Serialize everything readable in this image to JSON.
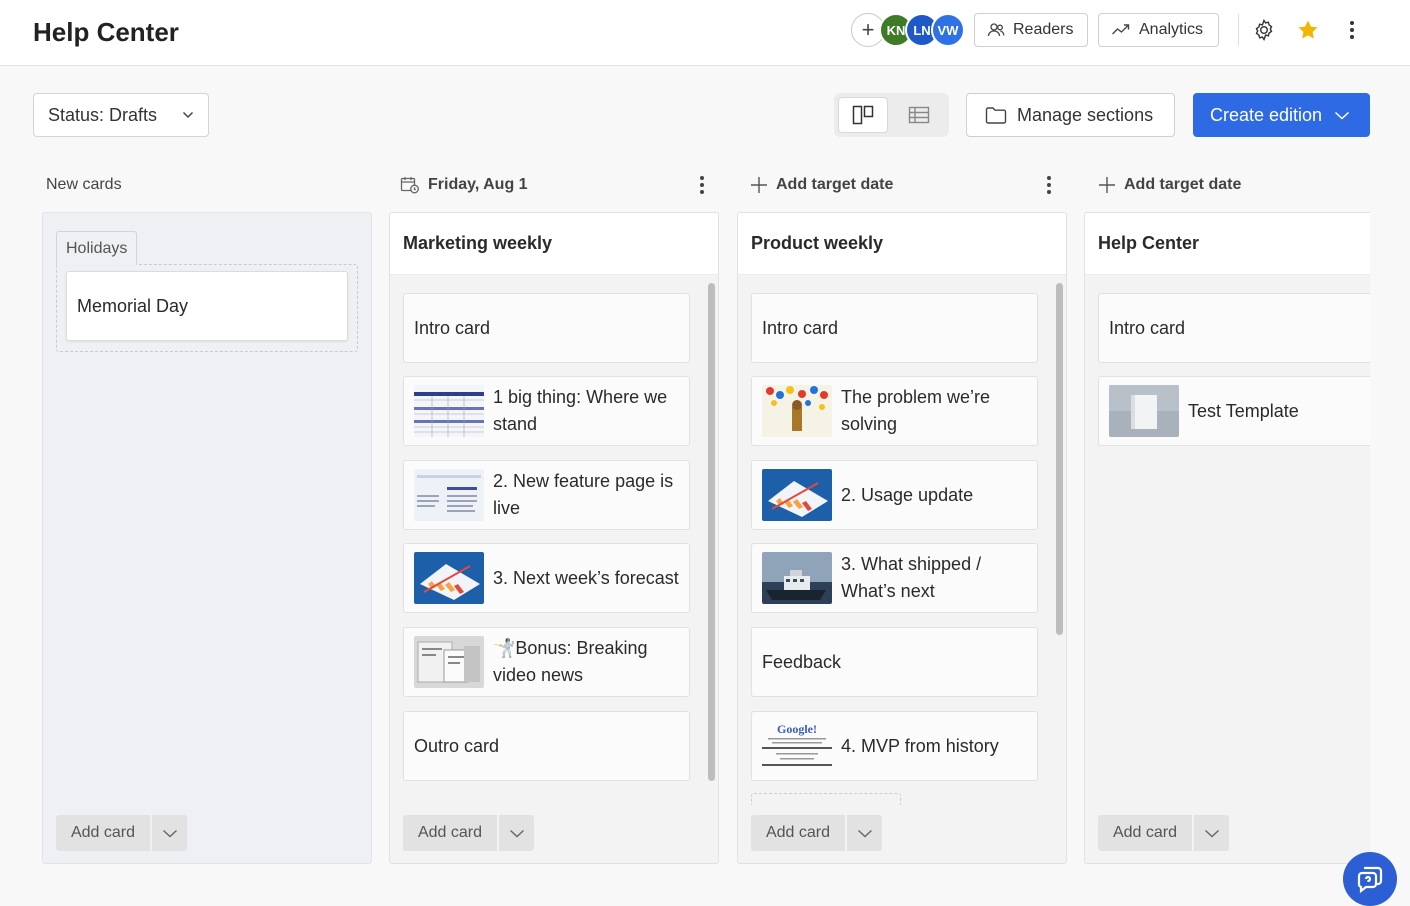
{
  "header": {
    "title": "Help Center",
    "avatars": [
      {
        "initials": "KN",
        "color": "#3e7b27"
      },
      {
        "initials": "LN",
        "color": "#1f58c8"
      },
      {
        "initials": "VW",
        "color": "#2f72e5"
      }
    ],
    "readers_label": "Readers",
    "analytics_label": "Analytics"
  },
  "toolbar": {
    "status_select": "Status: Drafts",
    "manage_sections_label": "Manage sections",
    "create_edition_label": "Create edition"
  },
  "columns": [
    {
      "header": "New cards",
      "group_label": "Holidays",
      "cards": [
        "Memorial Day"
      ],
      "add_card_label": "Add card"
    },
    {
      "header": "Friday, Aug 1",
      "title": "Marketing weekly",
      "cards": [
        {
          "text": "Intro card",
          "thumb": null
        },
        {
          "text": "1 big thing: Where we stand",
          "thumb": "table"
        },
        {
          "text": "2. New feature page is live",
          "thumb": "doc"
        },
        {
          "text": "3. Next week’s forecast",
          "thumb": "chart"
        },
        {
          "text": "🤺Bonus: Breaking video news",
          "thumb": "screens"
        },
        {
          "text": "Outro card",
          "thumb": null
        }
      ],
      "add_card_label": "Add card"
    },
    {
      "header": "Add target date",
      "title": "Product weekly",
      "cards": [
        {
          "text": "Intro card",
          "thumb": null
        },
        {
          "text": "The problem we’re solving",
          "thumb": "social"
        },
        {
          "text": "2. Usage update",
          "thumb": "chart"
        },
        {
          "text": "3. What shipped / What’s next",
          "thumb": "ship"
        },
        {
          "text": "Feedback",
          "thumb": null
        },
        {
          "text": "4. MVP from history",
          "thumb": "google"
        }
      ],
      "add_card_label": "Add card"
    },
    {
      "header": "Add target date",
      "title": "Help Center",
      "cards": [
        {
          "text": "Intro card",
          "thumb": null
        },
        {
          "text": "Test Template",
          "thumb": "template"
        }
      ],
      "add_card_label": "Add card"
    }
  ],
  "thumb_text": {
    "google": "Google!"
  },
  "colors": {
    "accent": "#2d6ae3",
    "star": "#f5b400",
    "fab": "#2d5fd4"
  }
}
